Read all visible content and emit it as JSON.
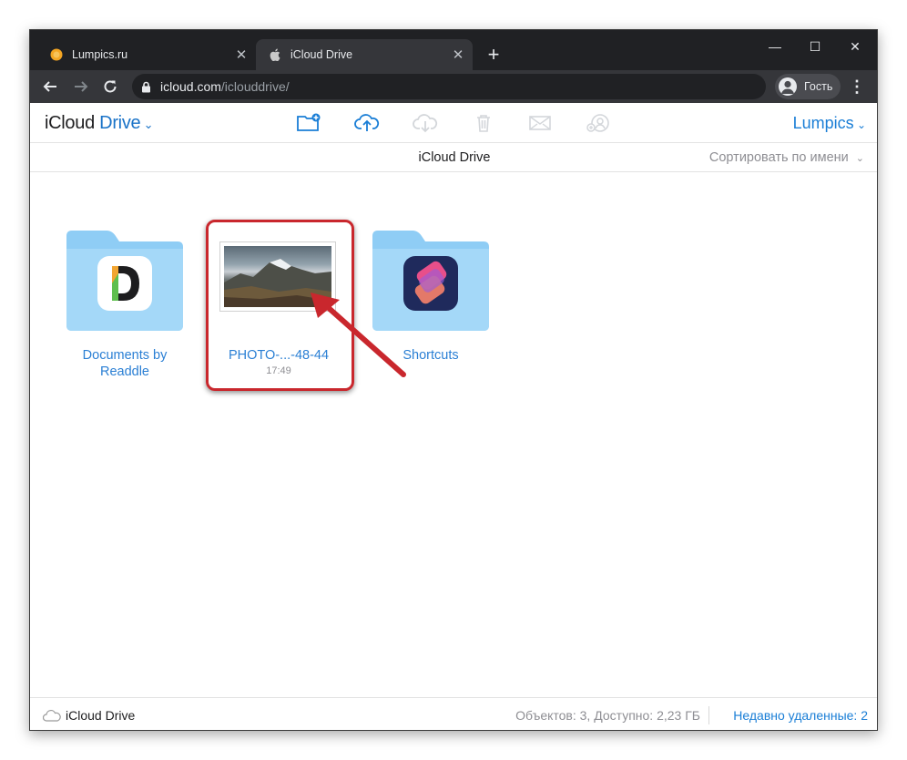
{
  "browser": {
    "tabs": [
      {
        "title": "Lumpics.ru",
        "close": "✕"
      },
      {
        "title": "iCloud Drive",
        "close": "✕"
      }
    ],
    "new_tab": "+",
    "window_controls": {
      "minimize": "—",
      "maximize": "☐",
      "close": "✕"
    },
    "url_host": "icloud.com",
    "url_path": "/iclouddrive/",
    "profile_label": "Гость"
  },
  "app": {
    "brand_icloud": "iCloud",
    "brand_drive": "Drive",
    "user_name": "Lumpics",
    "toolbar_icons": [
      "new-folder-icon",
      "upload-icon",
      "download-icon",
      "trash-icon",
      "mail-icon",
      "share-icon"
    ],
    "subheader_title": "iCloud Drive",
    "sort_label": "Сортировать по имени"
  },
  "items": [
    {
      "label_line1": "Documents by",
      "label_line2": "Readdle",
      "type": "folder"
    },
    {
      "label": "PHOTO-...-48-44",
      "time": "17:49",
      "type": "image"
    },
    {
      "label": "Shortcuts",
      "type": "folder"
    }
  ],
  "footer": {
    "location": "iCloud Drive",
    "stats": "Объектов: 3, Доступно: 2,23 ГБ",
    "recently_deleted": "Недавно удаленные: 2"
  },
  "colors": {
    "accent": "#1a7ed6",
    "folder": "#8fcdf5",
    "highlight": "#c9272d"
  }
}
